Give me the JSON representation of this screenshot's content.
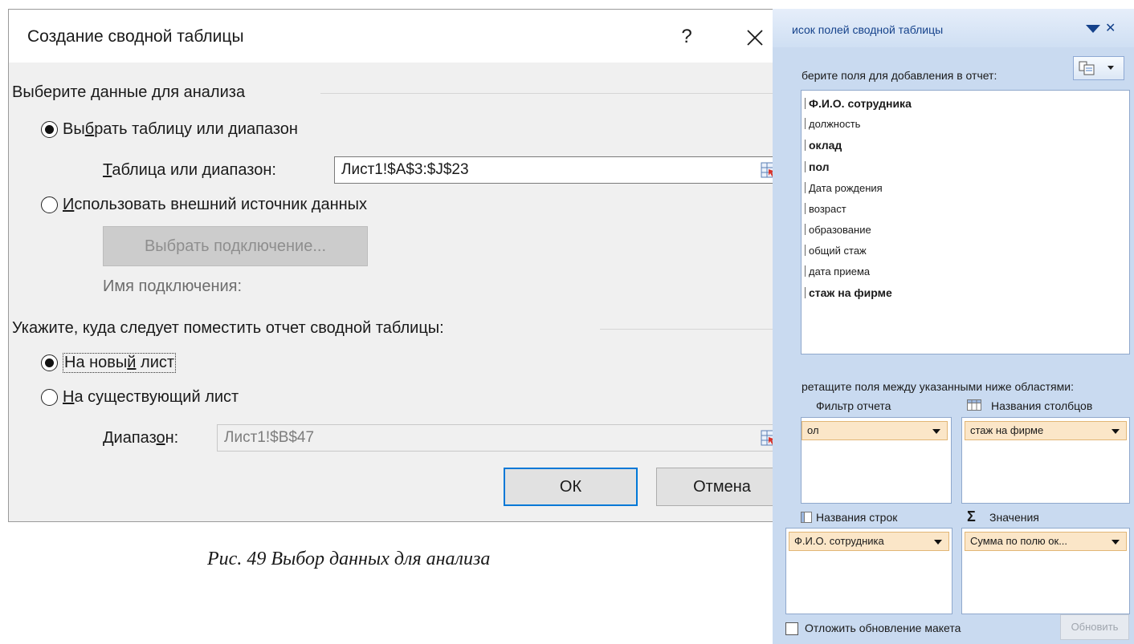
{
  "dialog": {
    "title": "Создание сводной таблицы",
    "help": "?",
    "section1_title": "Выберите данные для анализа",
    "option_table": {
      "pre": "Вы",
      "u": "б",
      "post": "рать таблицу или диапазон"
    },
    "range_label": {
      "u": "Т",
      "post": "аблица или диапазон:"
    },
    "range_value": "Лист1!$A$3:$J$23",
    "option_external": {
      "u": "И",
      "post": "спользовать внешний источник данных"
    },
    "choose_connection": "Выбрать подключение...",
    "connection_name_label": "Имя подключения:",
    "section2_title": "Укажите, куда следует поместить отчет сводной таблицы:",
    "option_new_sheet": {
      "pre": "На новы",
      "u": "й",
      "post": " лист"
    },
    "option_existing_sheet": {
      "u": "Н",
      "post": "а существующий лист"
    },
    "location_label": {
      "pre": "Диапаз",
      "u": "о",
      "post": "н:"
    },
    "location_value": "Лист1!$B$47",
    "ok": "ОК",
    "cancel": "Отмена"
  },
  "caption": "Рис. 49 Выбор данных для анализа",
  "pane": {
    "title": "исок полей сводной таблицы",
    "choose_fields_hint": "берите поля для добавления в отчет:",
    "fields": [
      {
        "label": "Ф.И.О. сотрудника",
        "bold": true
      },
      {
        "label": "должность",
        "bold": false
      },
      {
        "label": "оклад",
        "bold": true
      },
      {
        "label": "пол",
        "bold": true
      },
      {
        "label": "Дата рождения",
        "bold": false
      },
      {
        "label": "возраст",
        "bold": false
      },
      {
        "label": "образование",
        "bold": false
      },
      {
        "label": "общий стаж",
        "bold": false
      },
      {
        "label": "дата приема",
        "bold": false
      },
      {
        "label": "стаж на фирме",
        "bold": true
      }
    ],
    "drag_hint": "ретащите поля между указанными ниже областями:",
    "areas": {
      "report_filter": {
        "label": "Фильтр отчета",
        "chip": "ол"
      },
      "column_labels": {
        "label": "Названия столбцов",
        "chip": "стаж на фирме"
      },
      "row_labels": {
        "label": "Названия строк",
        "chip": "Ф.И.О. сотрудника"
      },
      "values": {
        "label": "Значения",
        "chip": "Сумма по полю ок..."
      }
    },
    "defer_update": "Отложить обновление макета",
    "update": "Обновить"
  }
}
